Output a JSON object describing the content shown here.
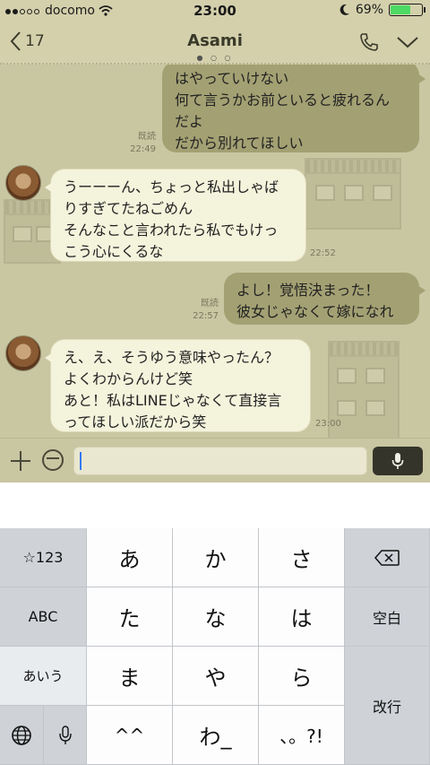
{
  "status": {
    "carrier": "docomo",
    "time": "23:00",
    "battery": "69%",
    "battery_level": 0.69
  },
  "header": {
    "back_count": "17",
    "title": "Asami",
    "pager": "● ○ ○"
  },
  "messages": [
    {
      "dir": "out",
      "lines": [
        "はやっていけない",
        "何て言うかお前といると疲れるん",
        "だよ",
        "だから別れてほしい"
      ],
      "read": "既読",
      "time": "22:49"
    },
    {
      "dir": "in",
      "lines": [
        "うーーーん、ちょっと私出しゃば",
        "りすぎてたねごめん",
        "そんなこと言われたら私でもけっ",
        "こう心にくるな"
      ],
      "time": "22:52"
    },
    {
      "dir": "out",
      "lines": [
        "よし！覚悟決まった！",
        "彼女じゃなくて嫁になれ"
      ],
      "read": "既読",
      "time": "22:57"
    },
    {
      "dir": "in",
      "lines": [
        "え、え、そうゆう意味やったん？",
        "よくわからんけど笑",
        "あと！私はLINEじゃなくて直接言",
        "ってほしい派だから笑"
      ],
      "time": "23:00"
    }
  ],
  "keyboard": {
    "left": [
      "☆123",
      "ABC",
      "あいう"
    ],
    "rows": [
      [
        "あ",
        "か",
        "さ"
      ],
      [
        "た",
        "な",
        "は"
      ],
      [
        "ま",
        "や",
        "ら"
      ],
      [
        "^^",
        "わ_",
        "、。?!"
      ]
    ],
    "space": "空白",
    "enter": "改行"
  }
}
